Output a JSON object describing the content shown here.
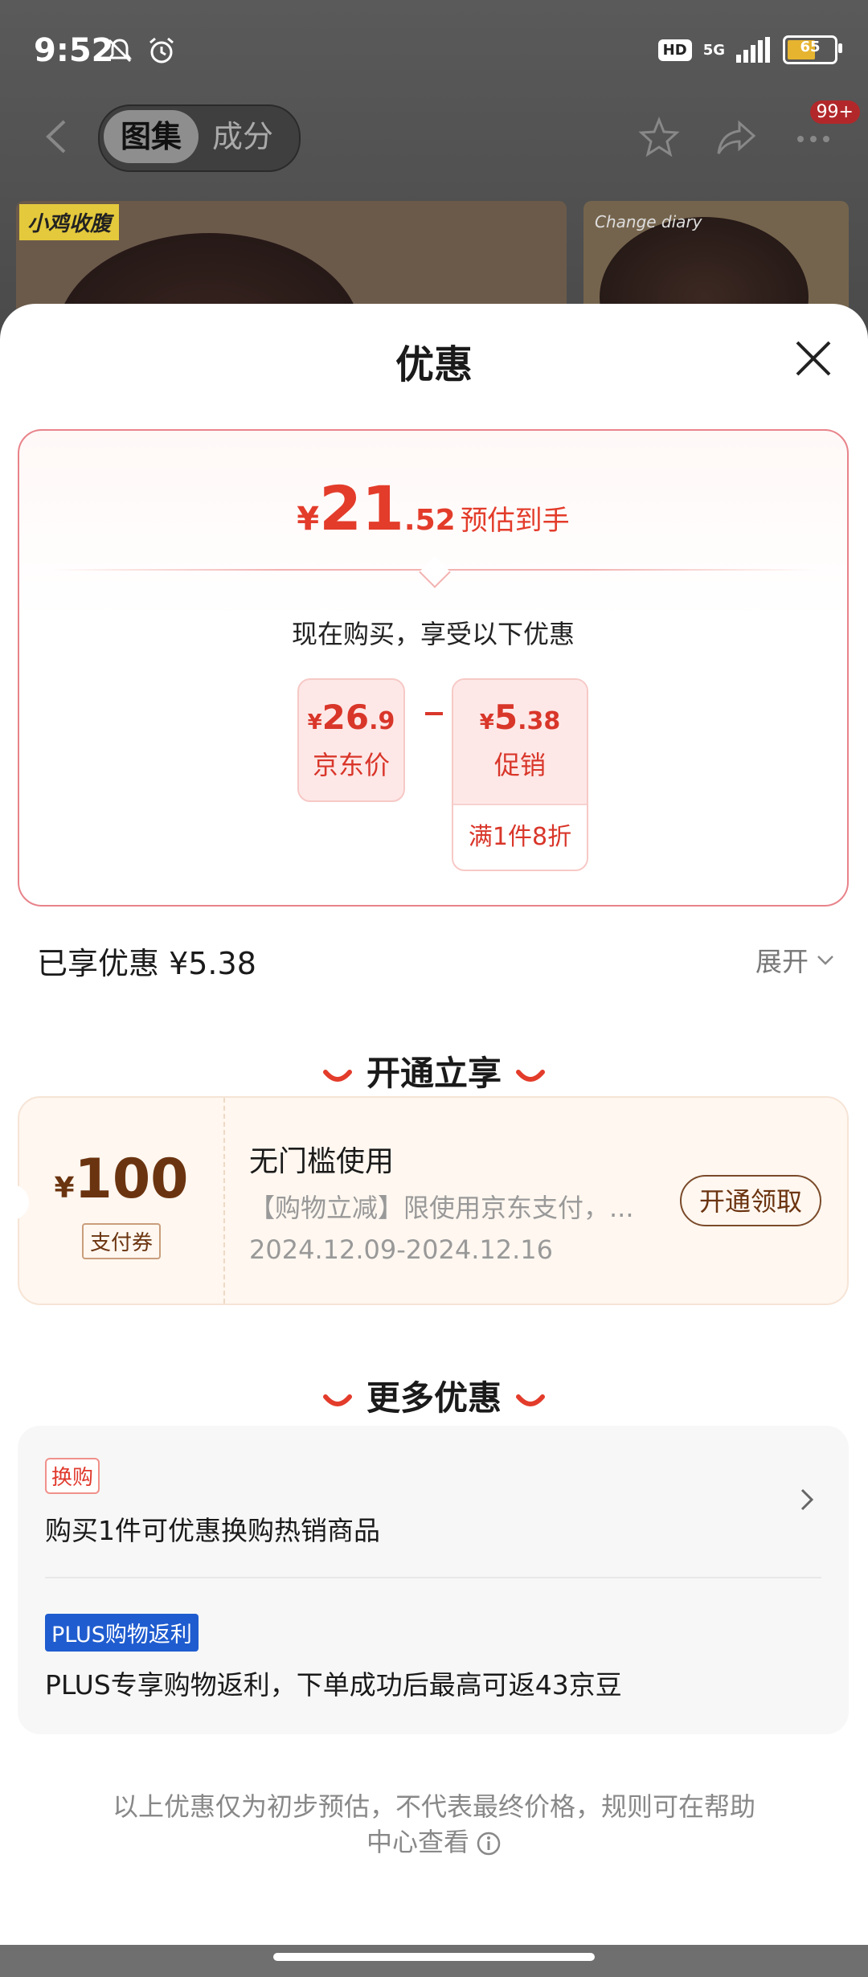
{
  "status_bar": {
    "time": "9:52",
    "network": "5G",
    "hd": "HD",
    "battery": "65",
    "battery_level": 0.65
  },
  "top_nav": {
    "tab_active": "图集",
    "tab_inactive": "成分",
    "badge": "99+"
  },
  "background": {
    "thumb1_tag": "小鸡收腹",
    "thumb2_tag": "Change diary"
  },
  "sheet": {
    "title": "优惠",
    "estimate": {
      "currency": "¥",
      "integer": "21",
      "decimal": ".52",
      "label": "预估到手"
    },
    "buy_now_text": "现在购买，享受以下优惠",
    "jd_price": {
      "currency": "¥",
      "integer": "26",
      "decimal": ".9",
      "label": "京东价"
    },
    "promo": {
      "currency": "¥",
      "integer": "5",
      "decimal": ".38",
      "label": "促销",
      "detail": "满1件8折"
    },
    "enjoyed_text": "已享优惠 ¥5.38",
    "expand_label": "展开",
    "section_open": "开通立享",
    "coupon": {
      "currency": "¥",
      "amount": "100",
      "tag": "支付券",
      "title": "无门槛使用",
      "desc": "【购物立减】限使用京东支付，...",
      "date": "2024.12.09-2024.12.16",
      "button": "开通领取"
    },
    "section_more": "更多优惠",
    "more": {
      "tag1": "换购",
      "text1": "购买1件可优惠换购热销商品",
      "tag2": "PLUS购物返利",
      "text2": "PLUS专享购物返利，下单成功后最高可返43京豆"
    },
    "disclaimer": "以上优惠仅为初步预估，不代表最终价格，规则可在帮助中心查看"
  },
  "colors": {
    "accent_red": "#e33c2b",
    "coupon_brown": "#6b3410",
    "plus_blue": "#1f5ccf"
  }
}
